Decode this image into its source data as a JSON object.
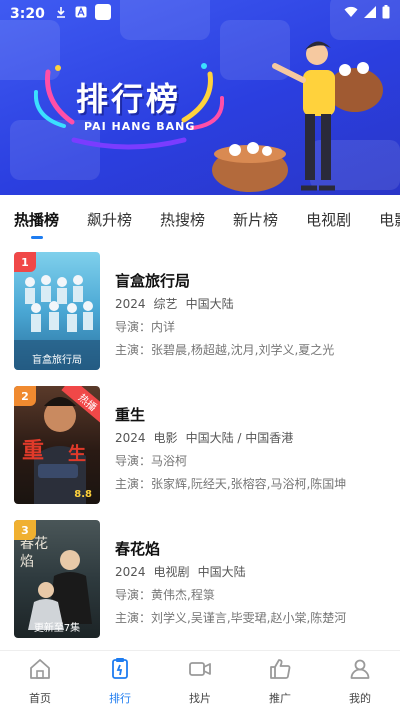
{
  "status_bar": {
    "time": "3:20"
  },
  "banner": {
    "title": "排行榜",
    "subtitle": "PAI HANG BANG"
  },
  "tabs": [
    {
      "label": "热播榜",
      "active": true
    },
    {
      "label": "飙升榜"
    },
    {
      "label": "热搜榜"
    },
    {
      "label": "新片榜"
    },
    {
      "label": "电视剧"
    },
    {
      "label": "电影"
    }
  ],
  "items": [
    {
      "rank": "1",
      "name": "盲盒旅行局",
      "year": "2024",
      "genre": "综艺",
      "region": "中国大陆",
      "director": "导演：内详",
      "cast": "主演：张碧晨,杨超越,沈月,刘学义,夏之光",
      "poster_caption": "盲盒旅行局",
      "rank_color": "#f04848",
      "poster_color": "#5db3d8"
    },
    {
      "rank": "2",
      "name": "重生",
      "year": "2024",
      "genre": "电影",
      "region": "中国大陆 / 中国香港",
      "director": "导演：马浴柯",
      "cast": "主演：张家辉,阮经天,张榕容,马浴柯,陈国坤",
      "poster_badge": "热播",
      "poster_caption": "8.8",
      "rank_color": "#f08a30",
      "poster_color": "#3a2a22"
    },
    {
      "rank": "3",
      "name": "春花焰",
      "year": "2024",
      "genre": "电视剧",
      "region": "中国大陆",
      "director": "导演：黄伟杰,程箓",
      "cast": "主演：刘学义,吴谨言,毕雯珺,赵小棠,陈楚河",
      "poster_caption": "更新至7集",
      "rank_color": "#f0b030",
      "poster_color": "#2e3a3e"
    }
  ],
  "nav": [
    {
      "label": "首页",
      "icon": "home-icon"
    },
    {
      "label": "排行",
      "icon": "ranking-icon",
      "active": true
    },
    {
      "label": "找片",
      "icon": "video-camera-icon"
    },
    {
      "label": "推广",
      "icon": "thumbs-up-icon"
    },
    {
      "label": "我的",
      "icon": "user-icon"
    }
  ],
  "colors": {
    "accent": "#1e7cf0",
    "banner": "#3a52ee"
  }
}
